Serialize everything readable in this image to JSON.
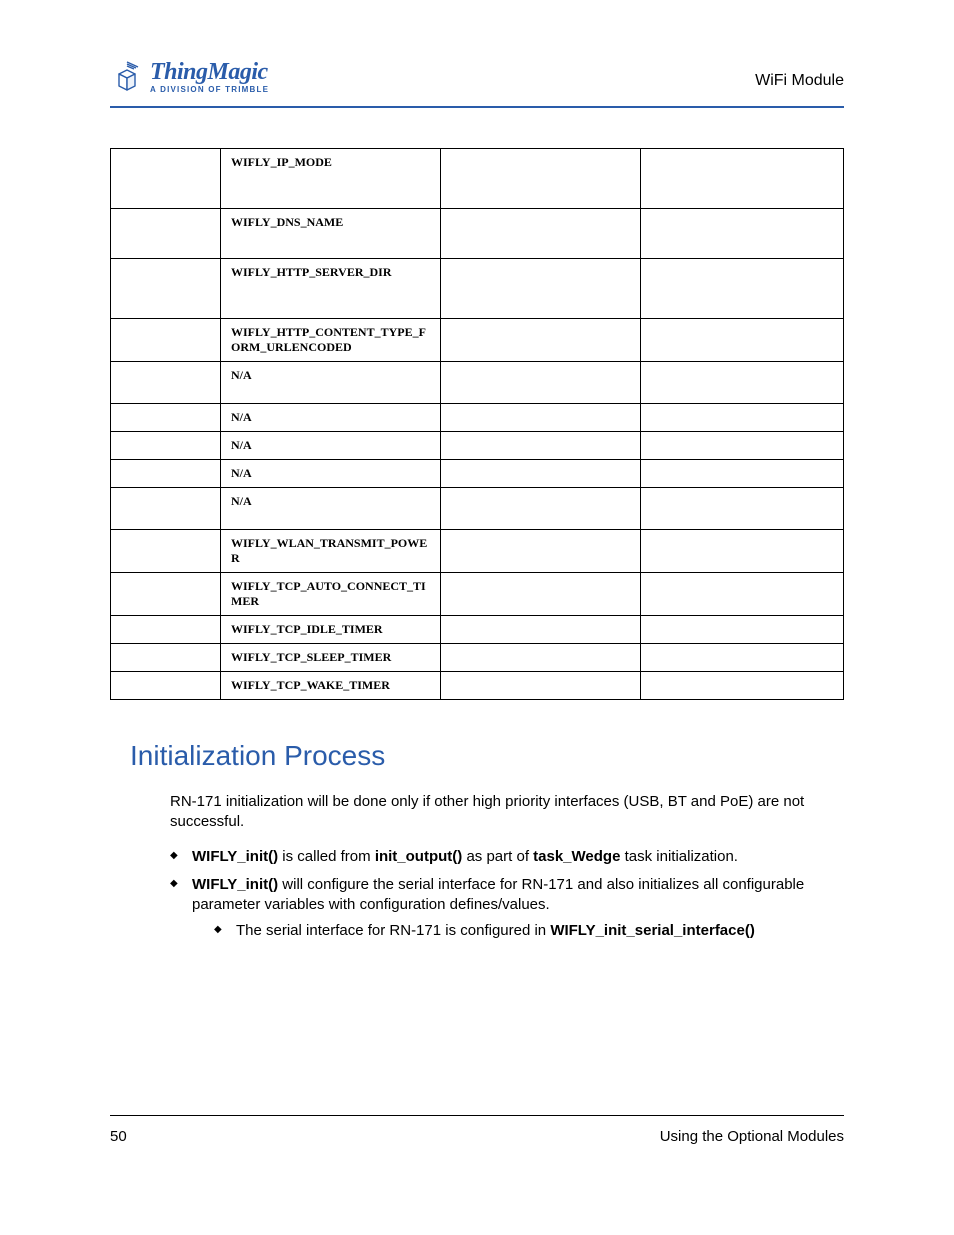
{
  "header": {
    "brand": "ThingMagic",
    "subtitle": "A DIVISION OF TRIMBLE",
    "right": "WiFi Module"
  },
  "table": {
    "rows": [
      {
        "c1": "",
        "c2": "WIFLY_IP_MODE",
        "c3": "",
        "c4": "",
        "cls": "h60"
      },
      {
        "c1": "",
        "c2": "WIFLY_DNS_NAME",
        "c3": "",
        "c4": "",
        "cls": "h50"
      },
      {
        "c1": "",
        "c2": "WIFLY_HTTP_SERVER_DIR",
        "c3": "",
        "c4": "",
        "cls": "h60"
      },
      {
        "c1": "",
        "c2": "WIFLY_HTTP_CONTENT_TYPE_FORM_URLENCODED",
        "c3": "",
        "c4": "",
        "cls": "h42"
      },
      {
        "c1": "",
        "c2": "N/A",
        "c3": "",
        "c4": "",
        "cls": "h42"
      },
      {
        "c1": "",
        "c2": "N/A",
        "c3": "",
        "c4": "",
        "cls": "h28"
      },
      {
        "c1": "",
        "c2": "N/A",
        "c3": "",
        "c4": "",
        "cls": "h28"
      },
      {
        "c1": "",
        "c2": "N/A",
        "c3": "",
        "c4": "",
        "cls": "h28"
      },
      {
        "c1": "",
        "c2": "N/A",
        "c3": "",
        "c4": "",
        "cls": "h42"
      },
      {
        "c1": "",
        "c2": "WIFLY_WLAN_TRANSMIT_POWER",
        "c3": "",
        "c4": "",
        "cls": "h42"
      },
      {
        "c1": "",
        "c2": "WIFLY_TCP_AUTO_CONNECT_TIMER",
        "c3": "",
        "c4": "",
        "cls": "h42"
      },
      {
        "c1": "",
        "c2": "WIFLY_TCP_IDLE_TIMER",
        "c3": "",
        "c4": "",
        "cls": "h28"
      },
      {
        "c1": "",
        "c2": "WIFLY_TCP_SLEEP_TIMER",
        "c3": "",
        "c4": "",
        "cls": "h28"
      },
      {
        "c1": "",
        "c2": "WIFLY_TCP_WAKE_TIMER",
        "c3": "",
        "c4": "",
        "cls": "h28"
      }
    ]
  },
  "section": {
    "heading": "Initialization Process",
    "intro": "RN-171 initialization will be done only if other high priority interfaces (USB, BT and PoE) are not successful.",
    "b1_a": "WIFLY_init()",
    "b1_b": " is called from ",
    "b1_c": "init_output()",
    "b1_d": " as part of ",
    "b1_e": "task_Wedge",
    "b1_f": " task initialization.",
    "b2_a": "WIFLY_init()",
    "b2_b": " will configure the serial interface for RN-171 and also initializes all configurable parameter variables with configuration defines/values.",
    "b2s_a": "The serial interface for RN-171 is configured in ",
    "b2s_b": "WIFLY_init_serial_interface()"
  },
  "footer": {
    "left": "50",
    "right": "Using the Optional Modules"
  }
}
